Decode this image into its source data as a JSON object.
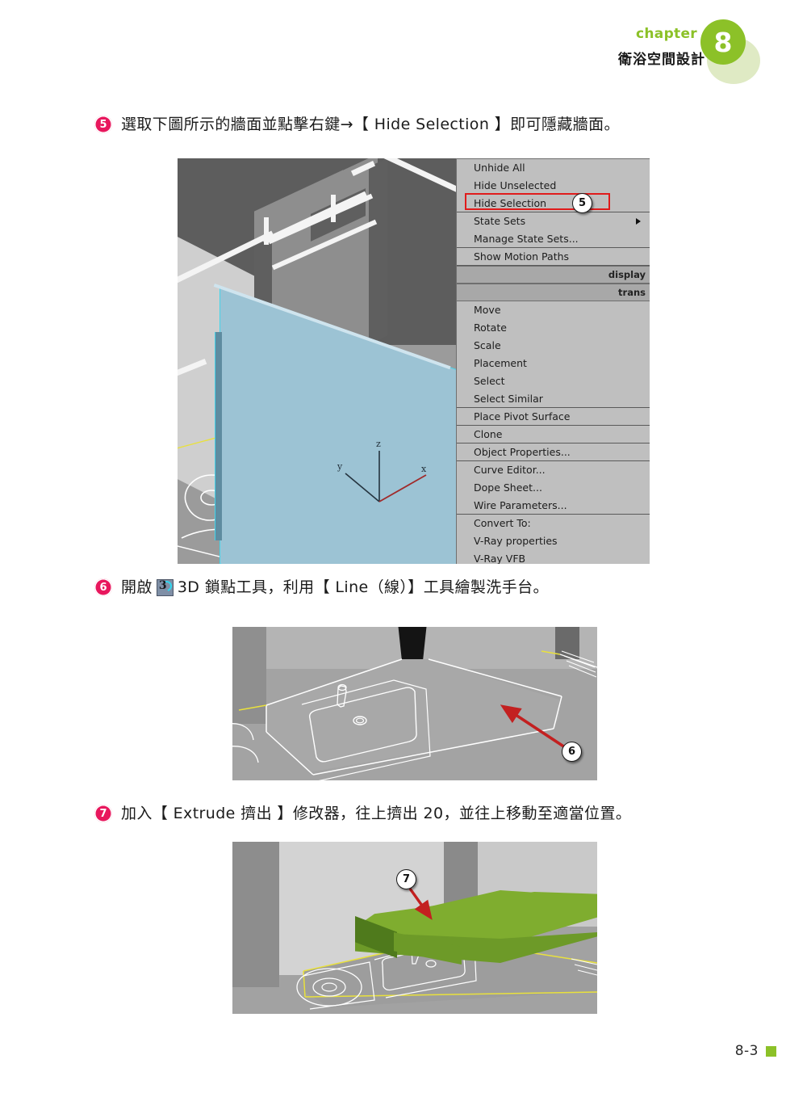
{
  "header": {
    "chapter_word": "chapter",
    "chapter_number": "8",
    "chapter_title": "衛浴空間設計",
    "accent_green": "#8cc128",
    "accent_green_pale": "#dfeac4"
  },
  "steps": [
    {
      "number": "5",
      "text": "選取下圖所示的牆面並點擊右鍵→【 Hide Selection 】即可隱藏牆面。"
    },
    {
      "number": "6",
      "text_before_icon": "開啟",
      "icon": "snap-3d-toggle-icon",
      "text_after_icon": "3D 鎖點工具，利用【 Line（線）】工具繪製洗手台。"
    },
    {
      "number": "7",
      "text": "加入【 Extrude 擠出 】修改器，往上擠出 20，並往上移動至適當位置。"
    }
  ],
  "figure1": {
    "caption_badge": "5",
    "quad_menu": {
      "groups": [
        {
          "items": [
            {
              "label": "Unhide All",
              "submenu": false,
              "highlighted": false
            },
            {
              "label": "Hide Unselected",
              "submenu": false,
              "highlighted": false
            },
            {
              "label": "Hide Selection",
              "submenu": false,
              "highlighted": true
            }
          ]
        },
        {
          "items": [
            {
              "label": "State Sets",
              "submenu": true,
              "highlighted": false
            },
            {
              "label": "Manage State Sets...",
              "submenu": false,
              "highlighted": false
            }
          ]
        },
        {
          "items": [
            {
              "label": "Show Motion Paths",
              "submenu": false,
              "highlighted": false
            }
          ]
        }
      ],
      "title_display": "display",
      "title_transform": "trans",
      "groups2": [
        {
          "items": [
            {
              "label": "Move"
            },
            {
              "label": "Rotate"
            },
            {
              "label": "Scale"
            },
            {
              "label": "Placement"
            },
            {
              "label": "Select"
            },
            {
              "label": "Select Similar"
            }
          ]
        },
        {
          "items": [
            {
              "label": "Place Pivot Surface"
            }
          ]
        },
        {
          "items": [
            {
              "label": "Clone"
            }
          ]
        },
        {
          "items": [
            {
              "label": "Object Properties..."
            }
          ]
        },
        {
          "items": [
            {
              "label": "Curve Editor..."
            },
            {
              "label": "Dope Sheet..."
            },
            {
              "label": "Wire Parameters..."
            }
          ]
        },
        {
          "items": [
            {
              "label": "Convert To:"
            },
            {
              "label": "V-Ray properties"
            },
            {
              "label": "V-Ray VFB"
            }
          ]
        }
      ]
    },
    "axis_labels": {
      "x": "x",
      "y": "y",
      "z": "z"
    },
    "selection_color": "#9cc3d4",
    "highlight_border": "#e01b1b"
  },
  "figure2": {
    "caption_badge": "6",
    "arrow_color": "#c32020"
  },
  "figure3": {
    "caption_badge": "7",
    "arrow_color": "#c32020",
    "extrude_top_color": "#7fad2f",
    "extrude_side_color": "#4f7a1c"
  },
  "footer": {
    "page": "8-3",
    "marker_color": "#8cc128"
  }
}
